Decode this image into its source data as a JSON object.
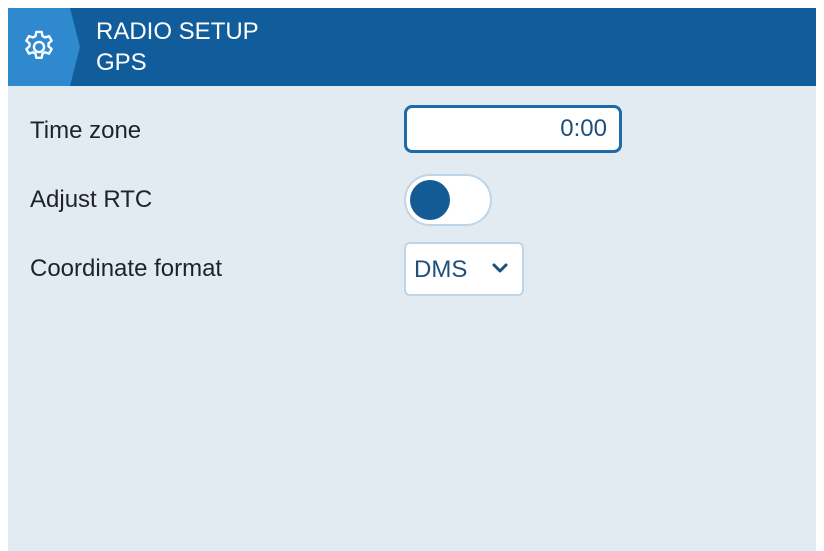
{
  "header": {
    "title": "RADIO SETUP",
    "subtitle": "GPS",
    "icon": "gear-icon"
  },
  "settings": {
    "time_zone": {
      "label": "Time zone",
      "value": "0:00"
    },
    "adjust_rtc": {
      "label": "Adjust RTC",
      "enabled": false
    },
    "coordinate_format": {
      "label": "Coordinate format",
      "selected": "DMS"
    }
  },
  "colors": {
    "header_bg": "#115c9a",
    "icon_tab_bg": "#2e89cf",
    "screen_bg": "#e2ebf1",
    "accent": "#145a94"
  }
}
